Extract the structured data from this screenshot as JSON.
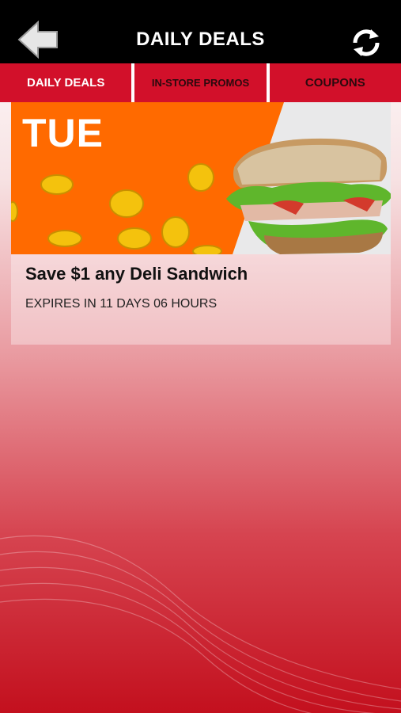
{
  "header": {
    "title": "DAILY DEALS"
  },
  "tabs": [
    {
      "label": "DAILY DEALS"
    },
    {
      "label": "IN-STORE PROMOS"
    },
    {
      "label": "COUPONS"
    }
  ],
  "deal": {
    "day_label": "TUE",
    "title": "Save $1 any Deli Sandwich",
    "expires": "EXPIRES IN 11 DAYS 06 HOURS"
  },
  "colors": {
    "topbar": "#000000",
    "tab_bar": "#d2102a",
    "banner_orange": "#ff6a00"
  },
  "icons": {
    "back": "arrow-left-icon",
    "refresh": "refresh-icon"
  }
}
